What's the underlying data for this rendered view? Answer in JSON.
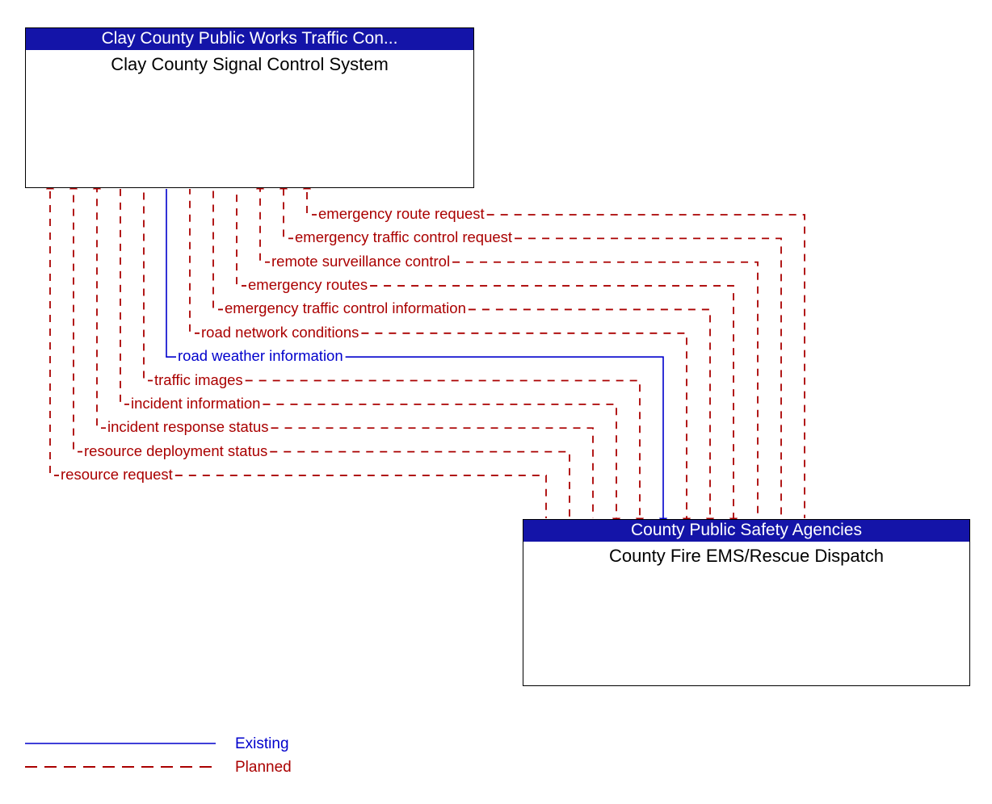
{
  "diagram": {
    "title": "Clay County Signal Control System to County Fire EMS/Rescue Dispatch interface diagram",
    "colors": {
      "planned": "#aa0000",
      "existing": "#0000cc",
      "box_header_bg": "#1414a8",
      "box_header_text": "#ffffff",
      "box_title_text": "#000000",
      "box_border": "#000000",
      "background": "#ffffff"
    }
  },
  "boxes": [
    {
      "id": "top",
      "header": "Clay County Public Works Traffic Con...",
      "title": "Clay County Signal Control System"
    },
    {
      "id": "bottom",
      "header": "County Public Safety Agencies",
      "title": "County Fire EMS/Rescue Dispatch"
    }
  ],
  "flows": [
    {
      "label": "emergency route request",
      "status": "Planned",
      "direction": "to-top"
    },
    {
      "label": "emergency traffic control request",
      "status": "Planned",
      "direction": "to-top"
    },
    {
      "label": "remote surveillance control",
      "status": "Planned",
      "direction": "to-top"
    },
    {
      "label": "emergency routes",
      "status": "Planned",
      "direction": "to-bottom"
    },
    {
      "label": "emergency traffic control information",
      "status": "Planned",
      "direction": "to-bottom"
    },
    {
      "label": "road network conditions",
      "status": "Planned",
      "direction": "to-bottom"
    },
    {
      "label": "road weather information",
      "status": "Existing",
      "direction": "to-bottom"
    },
    {
      "label": "traffic images",
      "status": "Planned",
      "direction": "to-bottom"
    },
    {
      "label": "incident information",
      "status": "Planned",
      "direction": "to-bottom"
    },
    {
      "label": "incident response status",
      "status": "Planned",
      "direction": "to-top"
    },
    {
      "label": "resource deployment status",
      "status": "Planned",
      "direction": "to-top"
    },
    {
      "label": "resource request",
      "status": "Planned",
      "direction": "to-top"
    }
  ],
  "legend": {
    "items": [
      {
        "label": "Existing",
        "style": "solid",
        "color": "#0000cc"
      },
      {
        "label": "Planned",
        "style": "dashed",
        "color": "#aa0000"
      }
    ]
  }
}
